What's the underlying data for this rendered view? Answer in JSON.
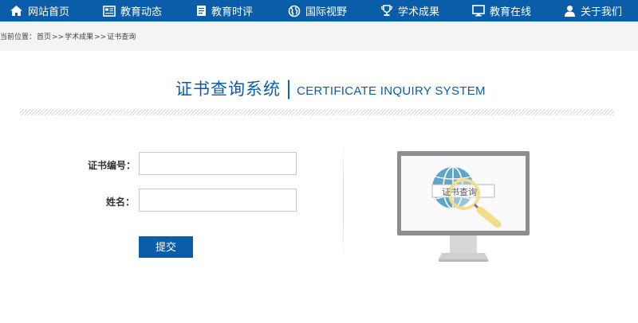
{
  "nav": {
    "items": [
      {
        "label": "网站首页",
        "icon": "home-icon"
      },
      {
        "label": "教育动态",
        "icon": "news-icon"
      },
      {
        "label": "教育时评",
        "icon": "document-icon"
      },
      {
        "label": "国际视野",
        "icon": "globe-icon"
      },
      {
        "label": "学术成果",
        "icon": "trophy-icon"
      },
      {
        "label": "教育在线",
        "icon": "monitor-icon"
      },
      {
        "label": "关于我们",
        "icon": "user-icon"
      }
    ]
  },
  "breadcrumb": {
    "prefix": "当前位置：",
    "items": [
      "首页",
      ">>",
      "学术成果",
      ">>",
      "证书查询"
    ]
  },
  "title": {
    "cn": "证书查询系统",
    "sep": "|",
    "en": "CERTIFICATE INQUIRY SYSTEM"
  },
  "form": {
    "cert_label": "证书编号：",
    "cert_value": "",
    "name_label": "姓名：",
    "name_value": "",
    "submit_label": "提交"
  },
  "illustration": {
    "search_text": "证书查询"
  },
  "colors": {
    "brand": "#0a5da8",
    "crumb_bg": "#f4f4f4"
  }
}
